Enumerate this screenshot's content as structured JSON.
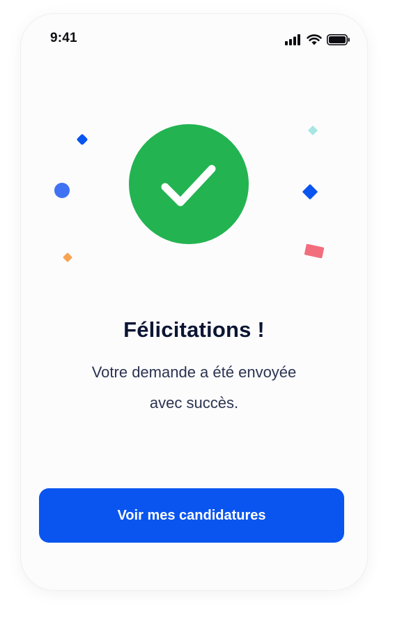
{
  "status_bar": {
    "time": "9:41",
    "icons": [
      "cellular-signal-icon",
      "wifi-icon",
      "battery-icon"
    ]
  },
  "success": {
    "icon": "checkmark-icon",
    "circle_color": "#23B351"
  },
  "confetti": [
    {
      "name": "confetti-diamond-blue",
      "color": "#0A55EF"
    },
    {
      "name": "confetti-circle-blue",
      "color": "#3F73F2"
    },
    {
      "name": "confetti-diamond-orange",
      "color": "#F6A453"
    },
    {
      "name": "confetti-diamond-teal",
      "color": "#A8E6E2"
    },
    {
      "name": "confetti-square-blue",
      "color": "#0A55EF"
    },
    {
      "name": "confetti-rect-red",
      "color": "#F26E7D"
    }
  ],
  "content": {
    "title": "Félicitations !",
    "message_line1": "Votre demande a été envoyée",
    "message_line2": "avec succès."
  },
  "actions": {
    "primary_label": "Voir mes candidatures",
    "primary_color": "#0A55EF"
  }
}
